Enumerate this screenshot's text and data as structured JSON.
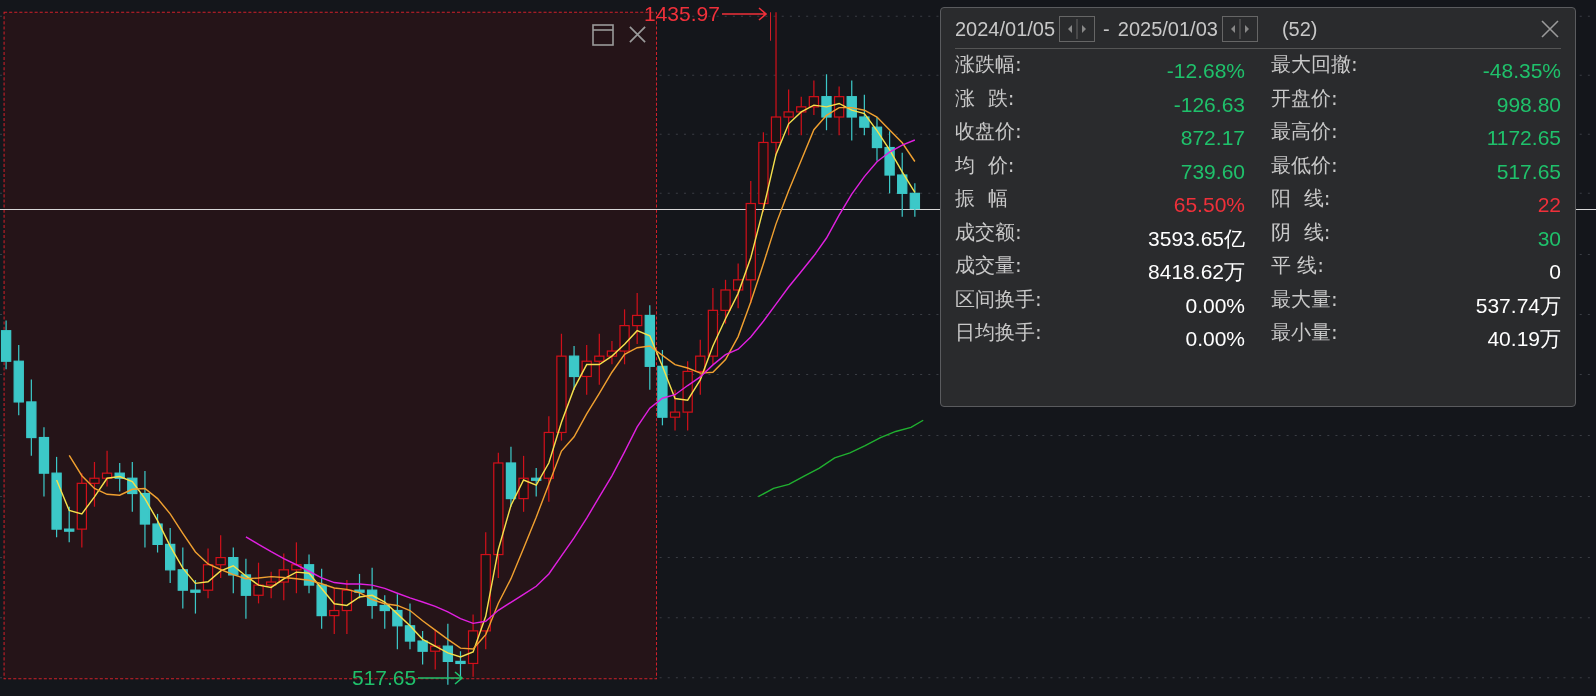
{
  "selection": {
    "high_label": "1435.97",
    "low_label": "517.65"
  },
  "panel": {
    "start_date": "2024/01/05",
    "end_date": "2025/01/03",
    "date_separator": "-",
    "count": "(52)",
    "stats_left": [
      {
        "label": "涨跌幅:",
        "value": "-12.68%",
        "color": "#1fc16b"
      },
      {
        "label": "涨  跌:",
        "value": "-126.63",
        "color": "#1fc16b"
      },
      {
        "label": "收盘价:",
        "value": "872.17",
        "color": "#1fc16b"
      },
      {
        "label": "均  价:",
        "value": "739.60",
        "color": "#1fc16b"
      },
      {
        "label": "振  幅",
        "value": "65.50%",
        "color": "#f0303a"
      },
      {
        "label": "成交额:",
        "value": "3593.65亿",
        "color": "#ffffff"
      },
      {
        "label": "成交量:",
        "value": "8418.62万",
        "color": "#ffffff"
      },
      {
        "label": "区间换手:",
        "value": "0.00%",
        "color": "#ffffff"
      },
      {
        "label": "日均换手:",
        "value": "0.00%",
        "color": "#ffffff"
      }
    ],
    "stats_right": [
      {
        "label": "最大回撤:",
        "value": "-48.35%",
        "color": "#1fc16b"
      },
      {
        "label": "开盘价:",
        "value": "998.80",
        "color": "#1fc16b"
      },
      {
        "label": "最高价:",
        "value": "1172.65",
        "color": "#1fc16b"
      },
      {
        "label": "最低价:",
        "value": "517.65",
        "color": "#1fc16b"
      },
      {
        "label": "阳  线:",
        "value": "22",
        "color": "#f0303a"
      },
      {
        "label": "阴  线:",
        "value": "30",
        "color": "#1fc16b"
      },
      {
        "label": "平 线:",
        "value": "0",
        "color": "#ffffff"
      },
      {
        "label": "最大量:",
        "value": "537.74万",
        "color": "#ffffff"
      },
      {
        "label": "最小量:",
        "value": "40.19万",
        "color": "#ffffff"
      }
    ]
  }
}
